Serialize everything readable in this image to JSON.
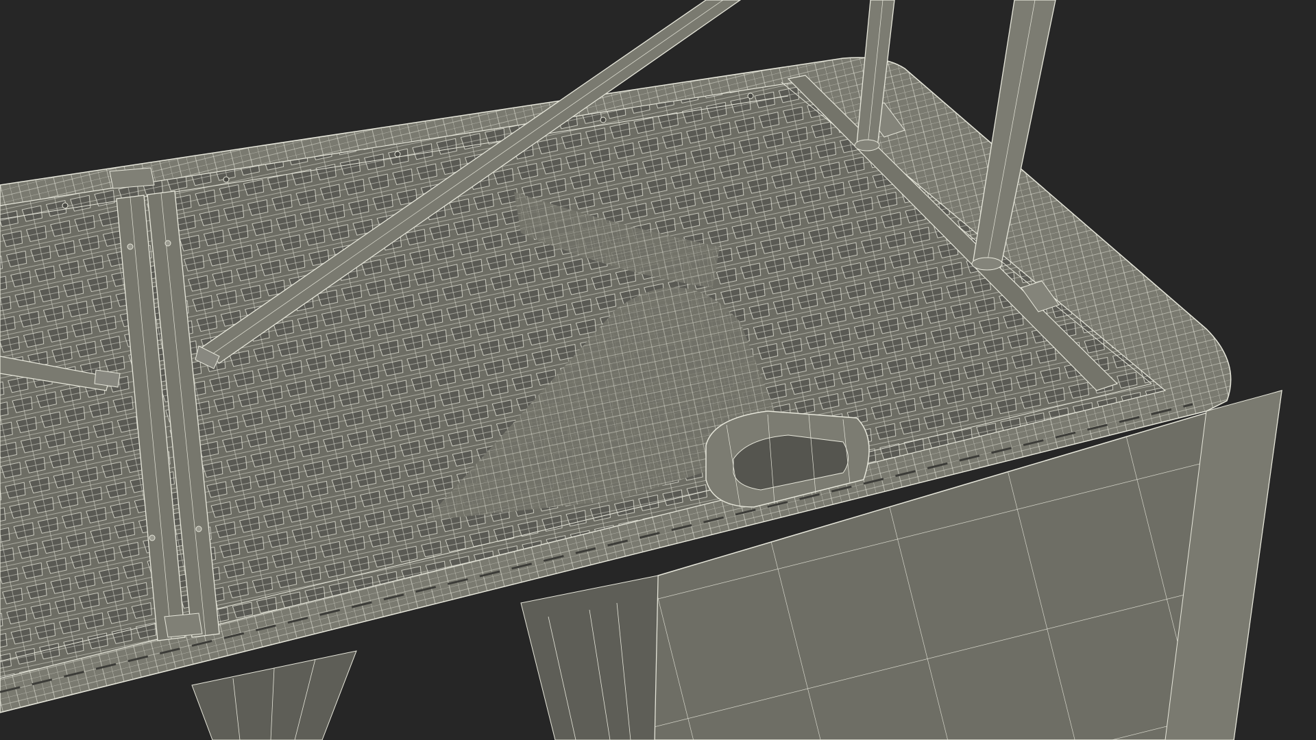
{
  "viewport": {
    "background_color": "#262626",
    "mesh_fill_color": "#6f6f66",
    "mesh_shadow_color": "#565650",
    "mesh_highlight_color": "#84847a",
    "wire_color": "#e8e8dc"
  },
  "scene": {
    "subject": "folding-table-underside-wireframe",
    "render_mode": "wireframe-over-shaded"
  }
}
